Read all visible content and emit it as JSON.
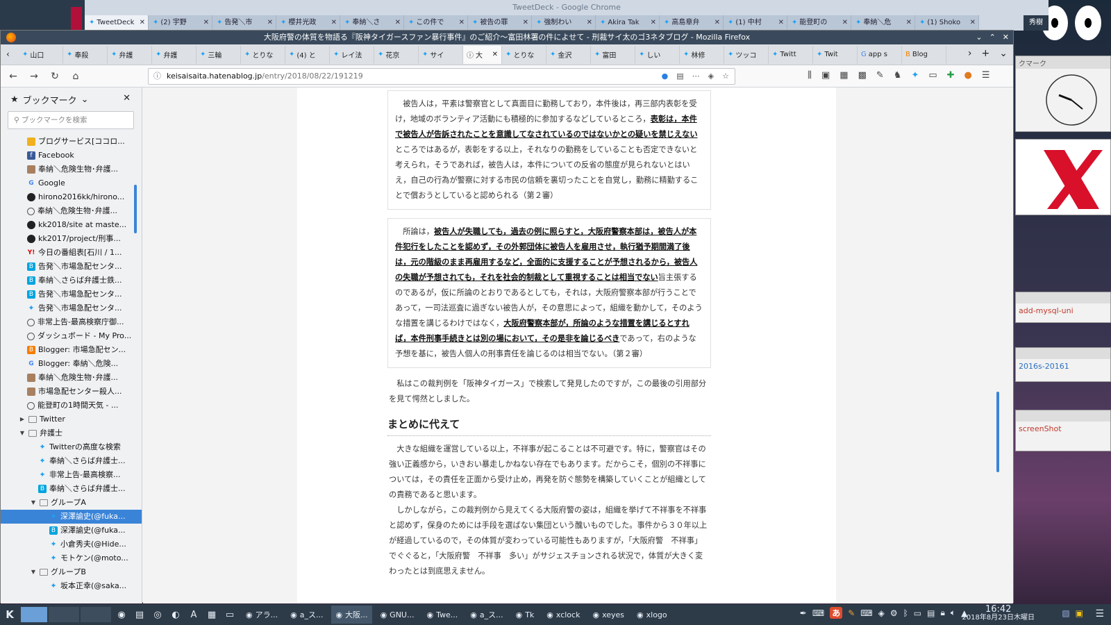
{
  "chrome": {
    "title": "TweetDeck - Google Chrome",
    "tabs": [
      {
        "label": "TweetDeck",
        "active": true
      },
      {
        "label": "(2) 宇野"
      },
      {
        "label": "告発＼市"
      },
      {
        "label": "櫻井光政"
      },
      {
        "label": "奉納＼さ"
      },
      {
        "label": "この件で"
      },
      {
        "label": "被告の罪"
      },
      {
        "label": "強制わい"
      },
      {
        "label": "Akira Tak"
      },
      {
        "label": "高島章弁"
      },
      {
        "label": "(1) 中村"
      },
      {
        "label": "能登町の"
      },
      {
        "label": "奉納＼危"
      },
      {
        "label": "(1) Shoko"
      }
    ],
    "user_badge": "秀樹"
  },
  "firefox": {
    "title": "大阪府警の体質を物語る『阪神タイガースファン暴行事件』のご紹介〜富田林署の件によせて - 刑裁サイ太のゴ3ネタブログ - Mozilla Firefox",
    "tabs": [
      {
        "label": "山口",
        "icon": "tw"
      },
      {
        "label": "奉殺",
        "icon": "tw"
      },
      {
        "label": "弁護",
        "icon": "tw"
      },
      {
        "label": "弁護",
        "icon": "tw"
      },
      {
        "label": "三輪",
        "icon": "tw"
      },
      {
        "label": "とりな",
        "icon": "tw"
      },
      {
        "label": "(4) と",
        "icon": "tw"
      },
      {
        "label": "レイ法",
        "icon": "tw"
      },
      {
        "label": "花京",
        "icon": "tw"
      },
      {
        "label": "サイ",
        "icon": "tw"
      },
      {
        "label": "大",
        "icon": "info",
        "active": true
      },
      {
        "label": "とりな",
        "icon": "tw"
      },
      {
        "label": "金沢",
        "icon": "tw"
      },
      {
        "label": "富田",
        "icon": "tw"
      },
      {
        "label": "しい",
        "icon": "tw"
      },
      {
        "label": "林修",
        "icon": "tw"
      },
      {
        "label": "ツッコ",
        "icon": "tw"
      },
      {
        "label": "Twitt",
        "icon": "tw"
      },
      {
        "label": "Twit",
        "icon": "tw"
      },
      {
        "label": "app s",
        "icon": "g"
      },
      {
        "label": "Blog",
        "icon": "bl"
      }
    ],
    "url_host": "keisaisaita.hatenablog.jp",
    "url_path": "/entry/2018/08/22/191219"
  },
  "sidebar": {
    "title": "ブックマーク",
    "search_placeholder": "ブックマークを検索",
    "items": [
      {
        "label": "ブログサービス[ココロ...",
        "icon": "grid",
        "depth": 0
      },
      {
        "label": "Facebook",
        "icon": "fb",
        "depth": 0
      },
      {
        "label": "奉納＼危険生物･弁護...",
        "icon": "img",
        "depth": 0
      },
      {
        "label": "Google",
        "icon": "g",
        "depth": 0
      },
      {
        "label": "hirono2016kk/hirono...",
        "icon": "gh",
        "depth": 0
      },
      {
        "label": "奉納＼危険生物･弁護...",
        "icon": "globe",
        "depth": 0
      },
      {
        "label": "kk2018/site at maste...",
        "icon": "gh",
        "depth": 0
      },
      {
        "label": "kk2017/project/刑事...",
        "icon": "gh",
        "depth": 0
      },
      {
        "label": "今日の番組表[石川 / 1...",
        "icon": "y",
        "depth": 0
      },
      {
        "label": "告発＼市場急配センタ...",
        "icon": "hb",
        "depth": 0
      },
      {
        "label": "奉納＼さらば弁護士鉄...",
        "icon": "hb",
        "depth": 0
      },
      {
        "label": "告発＼市場急配センタ...",
        "icon": "hb",
        "depth": 0
      },
      {
        "label": "告発＼市場急配センタ...",
        "icon": "tw",
        "depth": 0
      },
      {
        "label": "非常上告-最高検察庁御...",
        "icon": "globe",
        "depth": 0
      },
      {
        "label": "ダッシュボード - My Pro...",
        "icon": "globe",
        "depth": 0
      },
      {
        "label": "Blogger: 市場急配セン...",
        "icon": "bl",
        "depth": 0
      },
      {
        "label": "Blogger: 奉納＼危険...",
        "icon": "g",
        "depth": 0
      },
      {
        "label": "奉納＼危険生物･弁護...",
        "icon": "img",
        "depth": 0
      },
      {
        "label": "市場急配センター殺人...",
        "icon": "img",
        "depth": 0
      },
      {
        "label": "能登町の1時間天気 - ...",
        "icon": "globe",
        "depth": 0
      },
      {
        "label": "Twitter",
        "icon": "folder",
        "depth": 0,
        "toggle": "closed"
      },
      {
        "label": "弁護士",
        "icon": "folder",
        "depth": 0,
        "toggle": "open"
      },
      {
        "label": "Twitterの高度な検索",
        "icon": "tw",
        "depth": 1
      },
      {
        "label": "奉納＼さらば弁護士...",
        "icon": "tw",
        "depth": 1
      },
      {
        "label": "非常上告-最高検察...",
        "icon": "tw",
        "depth": 1
      },
      {
        "label": "奉納＼さらば弁護士...",
        "icon": "hb",
        "depth": 1
      },
      {
        "label": "グループA",
        "icon": "folder",
        "depth": 1,
        "toggle": "open"
      },
      {
        "label": "深澤諭史(@fuka...",
        "icon": "tw",
        "depth": 2,
        "selected": true
      },
      {
        "label": "深澤諭史(@fuka...",
        "icon": "hb",
        "depth": 2
      },
      {
        "label": "小倉秀夫(@Hide...",
        "icon": "tw",
        "depth": 2
      },
      {
        "label": "モトケン(@moto...",
        "icon": "tw",
        "depth": 2
      },
      {
        "label": "グループB",
        "icon": "folder",
        "depth": 1,
        "toggle": "open"
      },
      {
        "label": "坂本正幸(@saka...",
        "icon": "tw",
        "depth": 2
      }
    ]
  },
  "article": {
    "quote1": [
      {
        "text": "　被告人は，平素は警察官として真面目に勤務しており，本件後は，再三部内表彰を受け，地域のボランティア活動にも積極的に参加するなどしているところ，",
        "bold": false
      },
      {
        "text": "表彰は，本件で被告人が告訴されたことを意識してなされているのではないかとの疑いを禁じえない",
        "bold": true
      },
      {
        "text": "ところではあるが，表彰をする以上，それなりの勤務をしていることも否定できないと考えられ，そうであれば，被告人は，本件についての反省の態度が見られないとはいえ，自己の行為が警察に対する市民の信頼を裏切ったことを自覚し，勤務に精勤することで償おうとしていると認められる（第２審）",
        "bold": false
      }
    ],
    "quote2": [
      {
        "text": "　所論は，",
        "bold": false
      },
      {
        "text": "被告人が失職しても，過去の例に照らすと，大阪府警察本部は，被告人が本件犯行をしたことを認めず，その外郭団体に被告人を雇用させ，執行猶予期間満了後は，元の階級のまま再雇用するなど，全面的に支援することが予想されるから，被告人の失職が予想されても，それを社会的制裁として重視することは相当でない",
        "bold": true
      },
      {
        "text": "旨主張するのであるが，仮に所論のとおりであるとしても，それは，大阪府警察本部が行うことであって，一司法巡査に過ぎない被告人が，その意思によって，組織を動かして，そのような措置を講じるわけではなく，",
        "bold": false
      },
      {
        "text": "大阪府警察本部が，所論のような措置を講じるとすれば，本件刑事手続きとは別の場において，その是非を論じるべき",
        "bold": true
      },
      {
        "text": "であって，右のような予想を基に，被告人個人の刑事責任を論じるのは相当でない。（第２審）",
        "bold": false
      }
    ],
    "para1": "　私はこの裁判例を「阪神タイガース」で検索して発見したのですが，この最後の引用部分を見て愕然としました。",
    "heading": "まとめに代えて",
    "para2": "　大きな組織を運営している以上，不祥事が起こることは不可避です。特に，警察官はその強い正義感から，いきおい暴走しかねない存在でもあります。だからこそ，個別の不祥事については，その責任を正面から受け止め，再発を防ぐ態勢を構築していくことが組織としての責務であると思います。",
    "para3": "　しかしながら，この裁判例から見えてくる大阪府警の姿は，組織を挙げて不祥事を不祥事と認めず，保身のためには手段を選ばない集団という醜いものでした。事件から３０年以上が経過しているので，その体質が変わっている可能性もありますが，「大阪府警　不祥事」でぐぐると，「大阪府警　不祥事　多い」がサジェスチョンされる状況で，体質が大きく変わったとは到底思えません。"
  },
  "desktop_panels": [
    {
      "label": "クマーク"
    },
    {
      "label": "add-mysql-uni"
    },
    {
      "label": "2016s-20161"
    },
    {
      "label": "screenShot"
    }
  ],
  "taskbar": {
    "tasks": [
      {
        "label": "アラ..."
      },
      {
        "label": "a_ス..."
      },
      {
        "label": "大阪...",
        "active": true
      },
      {
        "label": "GNU..."
      },
      {
        "label": "Twe..."
      },
      {
        "label": "a_ス..."
      },
      {
        "label": "Tk"
      },
      {
        "label": "xclock"
      },
      {
        "label": "xeyes"
      },
      {
        "label": "xlogo"
      }
    ],
    "ime": "あ",
    "time": "16:42",
    "date": "2018年8月23日木曜日"
  },
  "colors": {
    "accent": "#3a84d8",
    "twitter": "#1da1f2"
  }
}
